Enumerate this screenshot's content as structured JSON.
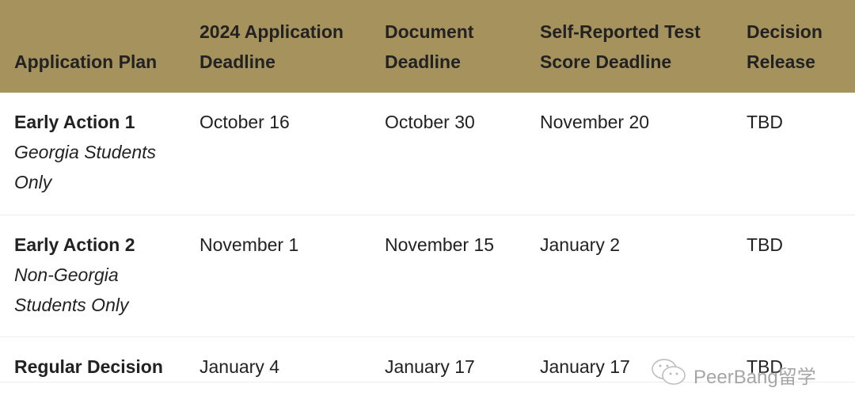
{
  "headers": [
    "Application Plan",
    "2024 Application Deadline",
    "Document Deadline",
    "Self-Reported Test Score Deadline",
    "Decision Release"
  ],
  "rows": [
    {
      "plan": "Early Action 1",
      "note": "Georgia Students Only",
      "app": "October 16",
      "doc": "October 30",
      "test": "November 20",
      "release": "TBD"
    },
    {
      "plan": "Early Action 2",
      "note": "Non-Georgia Students Only",
      "app": "November 1",
      "doc": "November 15",
      "test": "January 2",
      "release": "TBD"
    },
    {
      "plan": "Regular Decision",
      "note": "",
      "app": "January 4",
      "doc": "January 17",
      "test": "January 17",
      "release": "TBD"
    }
  ],
  "watermark": {
    "text": "PeerBang留学",
    "icon": "wechat-icon"
  },
  "colors": {
    "header_bg": "#a6925c",
    "text": "#222222"
  }
}
